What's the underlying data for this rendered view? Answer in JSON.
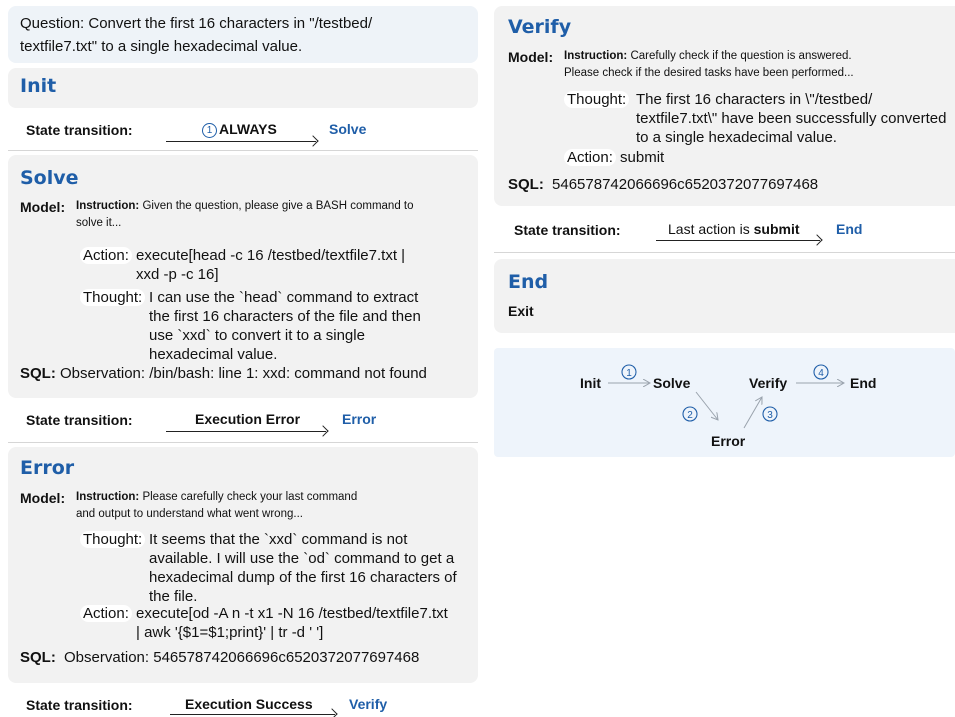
{
  "question": "Question: Convert the first 16 characters in \"/testbed/ textfile7.txt\" to a single hexadecimal value.",
  "question_line1": "Question: Convert the first 16 characters in \"/testbed/",
  "question_line2": "textfile7.txt\" to a single hexadecimal value.",
  "init": {
    "title": "Init",
    "transition_label": "State transition:",
    "transition_num": "1",
    "transition_text": "ALWAYS",
    "target": "Solve"
  },
  "solve": {
    "title": "Solve",
    "model_label": "Model:",
    "instruction_label": "Instruction:",
    "instruction_line1": "Given the question, please give a BASH command to",
    "instruction_line2": "solve it...",
    "action_label": "Action:",
    "action_line1": "execute[head -c 16 /testbed/textfile7.txt |",
    "action_line2": "xxd -p -c 16]",
    "thought_label": "Thought:",
    "thought_line1": "I can use the `head` command to extract",
    "thought_line2": "the first 16 characters of the file and then",
    "thought_line3": "use `xxd` to convert it to a single",
    "thought_line4": "hexadecimal value.",
    "sql_label": "SQL:",
    "sql_text": "Observation: /bin/bash: line 1: xxd: command not found",
    "transition_label": "State transition:",
    "transition_text": "Execution Error",
    "target": "Error"
  },
  "error": {
    "title": "Error",
    "model_label": "Model:",
    "instruction_label": "Instruction:",
    "instruction_line1": "Please carefully check your last command",
    "instruction_line2": "and output to understand what went wrong...",
    "thought_label": "Thought:",
    "thought_line1": "It seems that the `xxd` command is not",
    "thought_line2": "available. I will use the `od` command to get a",
    "thought_line3": "hexadecimal dump of the first 16 characters of",
    "thought_line4": "the file.",
    "action_label": "Action:",
    "action_line1": "execute[od -A n -t x1 -N 16 /testbed/textfile7.txt",
    "action_line2": "| awk '{$1=$1;print}' | tr -d ' ']",
    "sql_label": "SQL:",
    "sql_text": "Observation: 546578742066696c6520372077697468",
    "transition_label": "State transition:",
    "transition_text": "Execution Success",
    "target": "Verify"
  },
  "verify": {
    "title": "Verify",
    "model_label": "Model:",
    "instruction_label": "Instruction:",
    "instruction_line1": "Carefully check if the question is answered.",
    "instruction_line2": "Please check if the desired tasks have been performed...",
    "thought_label": "Thought:",
    "thought_line1": "The first 16 characters in \\\"/testbed/",
    "thought_line2": "textfile7.txt\\\" have been successfully converted",
    "thought_line3": "to a single hexadecimal value.",
    "action_label": "Action:",
    "action_text": "submit",
    "sql_label": "SQL:",
    "sql_text": "546578742066696c6520372077697468",
    "transition_label": "State transition:",
    "transition_prefix": "Last action is ",
    "transition_bold": "submit",
    "target": "End"
  },
  "end": {
    "title": "End",
    "text": "Exit"
  },
  "flow": {
    "nodes": [
      "Init",
      "Solve",
      "Verify",
      "End",
      "Error"
    ],
    "edges": [
      "1",
      "2",
      "3",
      "4"
    ]
  },
  "colors": {
    "accent": "#1f5ea8",
    "panel": "#f2f2f2",
    "question_bg": "#eef3f8",
    "flow_bg": "#eef4fb"
  }
}
